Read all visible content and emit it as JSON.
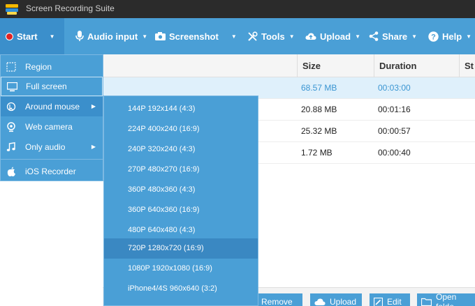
{
  "app": {
    "title": "Screen Recording Suite"
  },
  "toolbar": {
    "start": "Start",
    "audio": "Audio input",
    "screenshot": "Screenshot",
    "tools": "Tools",
    "upload": "Upload",
    "share": "Share",
    "help": "Help"
  },
  "table": {
    "columns": [
      "Size",
      "Duration",
      "St"
    ],
    "rows": [
      {
        "size": "68.57 MB",
        "duration": "00:03:00",
        "selected": true
      },
      {
        "size": "20.88 MB",
        "duration": "00:01:16"
      },
      {
        "size": "25.32 MB",
        "duration": "00:00:57"
      },
      {
        "size": "1.72 MB",
        "duration": "00:00:40"
      }
    ]
  },
  "start_menu": {
    "items": [
      {
        "label": "Region",
        "icon": "region-icon"
      },
      {
        "label": "Full screen",
        "icon": "monitor-icon"
      },
      {
        "label": "Around mouse",
        "icon": "mouse-icon",
        "submenu": true
      },
      {
        "label": "Web camera",
        "icon": "webcam-icon"
      },
      {
        "label": "Only audio",
        "icon": "music-icon",
        "submenu": true
      },
      {
        "label": "iOS Recorder",
        "icon": "apple-icon"
      }
    ]
  },
  "submenu": {
    "items": [
      "144P 192x144 (4:3)",
      "224P 400x240 (16:9)",
      "240P 320x240 (4:3)",
      "270P 480x270 (16:9)",
      "360P 480x360 (4:3)",
      "360P 640x360 (16:9)",
      "480P 640x480 (4:3)",
      "720P 1280x720 (16:9)",
      "1080P 1920x1080 (16:9)",
      "iPhone4/4S 960x640 (3:2)"
    ],
    "highlighted_index": 7
  },
  "bottom_bar": {
    "remove": "Remove",
    "upload": "Upload",
    "edit": "Edit",
    "open_folder": "Open folde"
  },
  "colors": {
    "toolbar": "#4a9fd6",
    "titlebar": "#2b2b2b",
    "selected_row_text": "#3a95d2"
  }
}
